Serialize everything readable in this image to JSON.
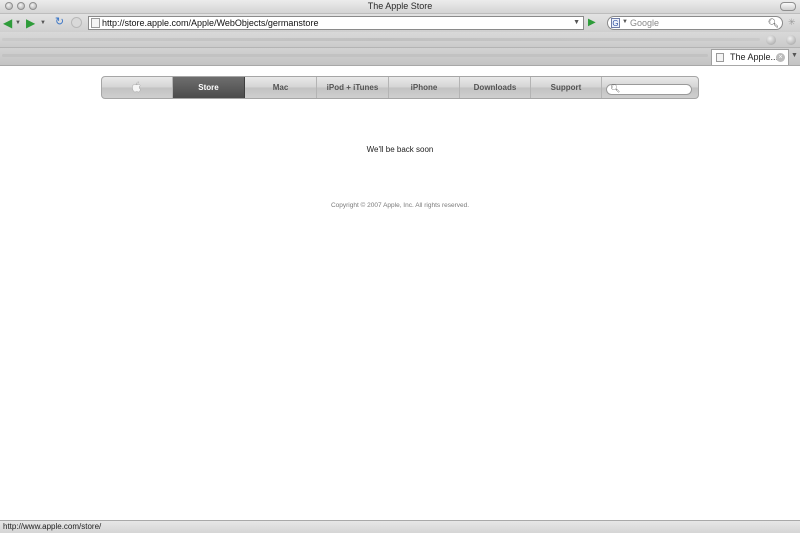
{
  "window": {
    "title": "The Apple Store"
  },
  "toolbar": {
    "url": "http://store.apple.com/Apple/WebObjects/germanstore",
    "search_placeholder": "Google",
    "search_engine_icon": "G"
  },
  "tabs": [
    {
      "label": "The Apple..."
    }
  ],
  "nav": {
    "items": [
      "Store",
      "Mac",
      "iPod + iTunes",
      "iPhone",
      "Downloads",
      "Support"
    ],
    "active": "Store"
  },
  "main": {
    "message": "We'll be back soon",
    "copyright": "Copyright © 2007 Apple, Inc. All rights reserved."
  },
  "status": {
    "text": "http://www.apple.com/store/"
  },
  "colors": {
    "active_nav": "#4b4b4b",
    "nav_bar": "#cfcfcf"
  }
}
